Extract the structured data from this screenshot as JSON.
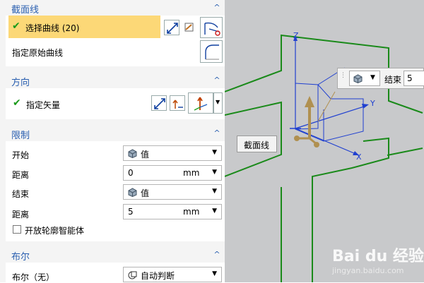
{
  "panel": {
    "section_curve": {
      "title": "截面线",
      "select_curve": "选择曲线 (20)",
      "origin_curve": "指定原始曲线"
    },
    "section_direction": {
      "title": "方向",
      "vector": "指定矢量"
    },
    "section_limits": {
      "title": "限制",
      "start_label": "开始",
      "start_value": "值",
      "distance1_label": "距离",
      "distance1_value": "0",
      "distance1_unit": "mm",
      "end_label": "结束",
      "end_value": "值",
      "distance2_label": "距离",
      "distance2_value": "5",
      "distance2_unit": "mm",
      "open_profile": "开放轮廓智能体"
    },
    "section_boolean": {
      "title": "布尔",
      "bool_label": "布尔（无）",
      "bool_value": "自动判断"
    }
  },
  "viewport": {
    "label": "截面线",
    "tool_end_label": "结束",
    "tool_end_value": "5",
    "axis_x": "X",
    "axis_y": "Y",
    "axis_z": "Z"
  },
  "watermark": {
    "brand": "Bai du 经验",
    "url": "jingyan.baidu.com"
  },
  "colors": {
    "accent": "#2a5fb0",
    "highlight": "#fcd877",
    "curve": "#1a8a1a"
  }
}
